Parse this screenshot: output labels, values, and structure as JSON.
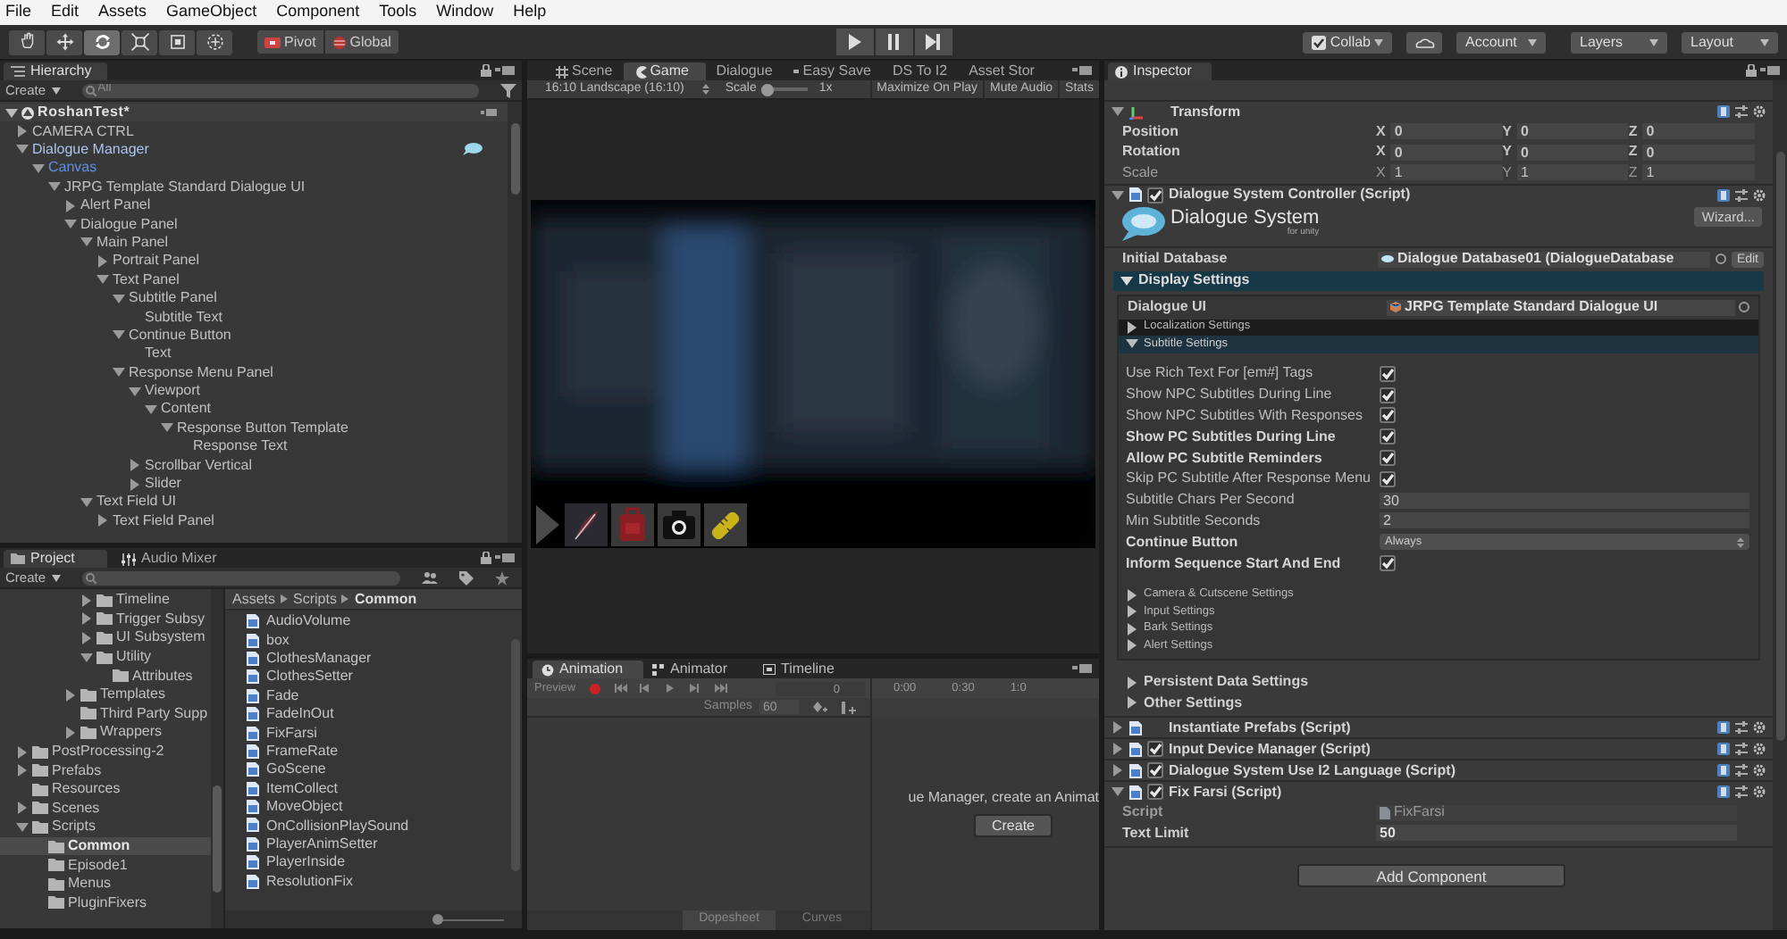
{
  "menu": [
    "File",
    "Edit",
    "Assets",
    "GameObject",
    "Component",
    "Tools",
    "Window",
    "Help"
  ],
  "toolbar": {
    "tools": [
      {
        "kind": "hand",
        "selected": false
      },
      {
        "kind": "move",
        "selected": false
      },
      {
        "kind": "rotate",
        "selected": true
      },
      {
        "kind": "scale",
        "selected": false
      },
      {
        "kind": "rect",
        "selected": false
      },
      {
        "kind": "transform",
        "selected": false
      }
    ],
    "pivot": "Pivot",
    "global": "Global",
    "collab": "Collab",
    "account": "Account",
    "layers": "Layers",
    "layout": "Layout"
  },
  "hierarchy": {
    "tab": "Hierarchy",
    "create": "Create",
    "search_placeholder": "All",
    "scene": "RoshanTest*",
    "items": [
      {
        "label": "CAMERA CTRL",
        "kind": "branch",
        "expanded": false
      },
      {
        "label": "Dialogue Manager",
        "kind": "branch",
        "expanded": true,
        "prefab": true,
        "cloud": true,
        "children": [
          {
            "label": "Canvas",
            "kind": "branch",
            "expanded": true,
            "prefab": true,
            "children": [
              {
                "label": "JRPG Template Standard Dialogue UI",
                "kind": "branch",
                "expanded": true,
                "children": [
                  {
                    "label": "Alert Panel",
                    "kind": "branch",
                    "expanded": false
                  },
                  {
                    "label": "Dialogue Panel",
                    "kind": "branch",
                    "expanded": true,
                    "children": [
                      {
                        "label": "Main Panel",
                        "kind": "branch",
                        "expanded": true,
                        "children": [
                          {
                            "label": "Portrait Panel",
                            "kind": "branch",
                            "expanded": false
                          },
                          {
                            "label": "Text Panel",
                            "kind": "branch",
                            "expanded": true,
                            "children": [
                              {
                                "label": "Subtitle Panel",
                                "kind": "branch",
                                "expanded": true,
                                "children": [
                                  {
                                    "label": "Subtitle Text",
                                    "kind": "leaf"
                                  }
                                ]
                              },
                              {
                                "label": "Continue Button",
                                "kind": "branch",
                                "expanded": true,
                                "children": [
                                  {
                                    "label": "Text",
                                    "kind": "leaf"
                                  }
                                ]
                              },
                              {
                                "label": "Response Menu Panel",
                                "kind": "branch",
                                "expanded": true,
                                "children": [
                                  {
                                    "label": "Viewport",
                                    "kind": "branch",
                                    "expanded": true,
                                    "children": [
                                      {
                                        "label": "Content",
                                        "kind": "branch",
                                        "expanded": true,
                                        "children": [
                                          {
                                            "label": "Response Button Template",
                                            "kind": "branch",
                                            "expanded": true,
                                            "children": [
                                              {
                                                "label": "Response Text",
                                                "kind": "leaf"
                                              }
                                            ]
                                          }
                                        ]
                                      }
                                    ]
                                  },
                                  {
                                    "label": "Scrollbar Vertical",
                                    "kind": "branch",
                                    "expanded": false
                                  },
                                  {
                                    "label": "Slider",
                                    "kind": "branch",
                                    "expanded": false
                                  }
                                ]
                              }
                            ]
                          }
                        ]
                      },
                      {
                        "label": "Text Field UI",
                        "kind": "branch",
                        "expanded": true,
                        "children": [
                          {
                            "label": "Text Field Panel",
                            "kind": "branch",
                            "expanded": false
                          }
                        ]
                      }
                    ]
                  }
                ]
              }
            ]
          }
        ]
      }
    ]
  },
  "project": {
    "tabs": [
      {
        "label": "Project",
        "selected": true
      },
      {
        "label": "Audio Mixer",
        "selected": false
      }
    ],
    "create": "Create",
    "folders_tail_level4": [
      {
        "label": "Timeline",
        "kind": "branch",
        "expanded": false,
        "selected": false
      },
      {
        "label": "Trigger Subsy",
        "kind": "branch",
        "expanded": false,
        "selected": false
      },
      {
        "label": "UI Subsystem",
        "kind": "branch",
        "expanded": false,
        "selected": false
      },
      {
        "label": "Utility",
        "kind": "branch",
        "expanded": true,
        "selected": false,
        "children": [
          {
            "label": "Attributes",
            "kind": "leaf",
            "selected": false
          }
        ]
      }
    ],
    "folders_tail_level3": [
      {
        "label": "Templates",
        "kind": "branch",
        "expanded": false,
        "selected": false
      },
      {
        "label": "Third Party Supp",
        "kind": "leaf",
        "selected": false
      },
      {
        "label": "Wrappers",
        "kind": "branch",
        "expanded": false,
        "selected": false
      }
    ],
    "folders": [
      {
        "label": "PostProcessing-2",
        "kind": "branch",
        "expanded": false,
        "selected": false
      },
      {
        "label": "Prefabs",
        "kind": "branch",
        "expanded": false,
        "selected": false
      },
      {
        "label": "Resources",
        "kind": "leaf",
        "selected": false
      },
      {
        "label": "Scenes",
        "kind": "branch",
        "expanded": false,
        "selected": false
      },
      {
        "label": "Scripts",
        "kind": "branch",
        "expanded": true,
        "selected": false,
        "children": [
          {
            "label": "Common",
            "kind": "leaf",
            "selected": true
          },
          {
            "label": "Episode1",
            "kind": "leaf",
            "selected": false
          },
          {
            "label": "Menus",
            "kind": "leaf",
            "selected": false
          },
          {
            "label": "PluginFixers",
            "kind": "leaf",
            "selected": false
          }
        ]
      }
    ],
    "breadcrumb": [
      "Assets",
      "Scripts",
      "Common"
    ],
    "zoom_slider": {
      "level": 0
    },
    "files": [
      "AudioVolume",
      "box",
      "ClothesManager",
      "ClothesSetter",
      "Fade",
      "FadeInOut",
      "FixFarsi",
      "FrameRate",
      "GoScene",
      "ItemCollect",
      "MoveObject",
      "OnCollisionPlaySound",
      "PlayerAnimSetter",
      "PlayerInside",
      "ResolutionFix"
    ]
  },
  "view": {
    "tabs": [
      {
        "label": "Scene",
        "kind": "scene",
        "selected": false
      },
      {
        "label": "Game",
        "kind": "game",
        "selected": true
      },
      {
        "label": "Dialogue",
        "kind": "plain",
        "selected": false
      },
      {
        "label": "Easy Save",
        "kind": "dot",
        "selected": false
      },
      {
        "label": "DS To I2",
        "kind": "plain",
        "selected": false
      },
      {
        "label": "Asset Stor",
        "kind": "plain",
        "selected": false
      }
    ],
    "display": "16:10 Landscape (16:10)",
    "scale_label": "Scale",
    "scale_slider": {
      "level": 0
    },
    "scale_value": "1x",
    "toggles": [
      {
        "label": "Maximize On Play",
        "on": false
      },
      {
        "label": "Mute Audio",
        "on": false
      },
      {
        "label": "Stats",
        "on": false
      }
    ]
  },
  "animation": {
    "tabs": [
      {
        "label": "Animation",
        "selected": true
      },
      {
        "label": "Animator",
        "selected": false
      },
      {
        "label": "Timeline",
        "selected": false
      }
    ],
    "preview": "Preview",
    "frame": "0",
    "ruler": [
      "0:00",
      "0:30",
      "1:0"
    ],
    "samples_label": "Samples",
    "samples": "60",
    "message": "ue Manager, create an Animat",
    "create": "Create",
    "views": [
      {
        "label": "Dopesheet",
        "selected": true
      },
      {
        "label": "Curves",
        "selected": false
      }
    ]
  },
  "inspector": {
    "tab": "Inspector",
    "transform": {
      "title": "Transform",
      "rows": [
        {
          "label": "Position",
          "modified": true,
          "values": [
            {
              "axis": "X",
              "value": "0"
            },
            {
              "axis": "Y",
              "value": "0"
            },
            {
              "axis": "Z",
              "value": "0"
            }
          ]
        },
        {
          "label": "Rotation",
          "modified": true,
          "values": [
            {
              "axis": "X",
              "value": "0"
            },
            {
              "axis": "Y",
              "value": "0"
            },
            {
              "axis": "Z",
              "value": "0"
            }
          ]
        },
        {
          "label": "Scale",
          "modified": false,
          "values": [
            {
              "axis": "X",
              "value": "1"
            },
            {
              "axis": "Y",
              "value": "1"
            },
            {
              "axis": "Z",
              "value": "1"
            }
          ]
        }
      ]
    },
    "controller": {
      "title": "Dialogue System Controller (Script)",
      "enabled": true,
      "logo_title": "Dialogue System",
      "logo_subtitle": "for unity",
      "wizard": "Wizard...",
      "database_label": "Initial Database",
      "database_value": "Dialogue Database01 (DialogueDatabase",
      "edit": "Edit",
      "display_settings": "Display Settings",
      "dialogue_ui_label": "Dialogue UI",
      "dialogue_ui_value": "JRPG Template Standard Dialogue UI",
      "sections": [
        {
          "label": "Localization Settings",
          "expanded": false
        },
        {
          "label": "Subtitle Settings",
          "expanded": true,
          "fields": [
            {
              "kind": "checkbox",
              "label": "Use Rich Text For [em#] Tags",
              "checked": true,
              "modified": false
            },
            {
              "kind": "checkbox",
              "label": "Show NPC Subtitles During Line",
              "checked": true,
              "modified": false
            },
            {
              "kind": "checkbox",
              "label": "Show NPC Subtitles With Responses",
              "checked": true,
              "modified": false
            },
            {
              "kind": "checkbox",
              "label": "Show PC Subtitles During Line",
              "checked": true,
              "modified": true
            },
            {
              "kind": "checkbox",
              "label": "Allow PC Subtitle Reminders",
              "checked": true,
              "modified": true
            },
            {
              "kind": "checkbox",
              "label": "Skip PC Subtitle After Response Menu",
              "checked": true,
              "modified": false
            },
            {
              "kind": "number",
              "label": "Subtitle Chars Per Second",
              "value": "30",
              "modified": false
            },
            {
              "kind": "number",
              "label": "Min Subtitle Seconds",
              "value": "2",
              "modified": false
            },
            {
              "kind": "dropdown",
              "label": "Continue Button",
              "value": "Always",
              "modified": true
            },
            {
              "kind": "checkbox",
              "label": "Inform Sequence Start And End",
              "checked": true,
              "modified": true
            }
          ]
        },
        {
          "label": "Camera & Cutscene Settings",
          "expanded": false
        },
        {
          "label": "Input Settings",
          "expanded": false
        },
        {
          "label": "Bark Settings",
          "expanded": false
        },
        {
          "label": "Alert Settings",
          "expanded": false
        }
      ],
      "outer_sections": [
        {
          "label": "Persistent Data Settings",
          "expanded": false
        },
        {
          "label": "Other Settings",
          "expanded": false
        }
      ]
    },
    "components": [
      {
        "title": "Instantiate Prefabs (Script)",
        "kind": "plain"
      },
      {
        "title": "Input Device Manager (Script)",
        "kind": "toggle",
        "enabled": true
      },
      {
        "title": "Dialogue System Use I2 Language (Script)",
        "kind": "toggle",
        "enabled": true
      },
      {
        "title": "Fix Farsi (Script)",
        "kind": "toggle",
        "enabled": true,
        "fields": [
          {
            "kind": "object",
            "label": "Script",
            "value": "FixFarsi"
          },
          {
            "kind": "number",
            "label": "Text Limit",
            "value": "50"
          }
        ]
      }
    ],
    "add_component": "Add Component"
  }
}
